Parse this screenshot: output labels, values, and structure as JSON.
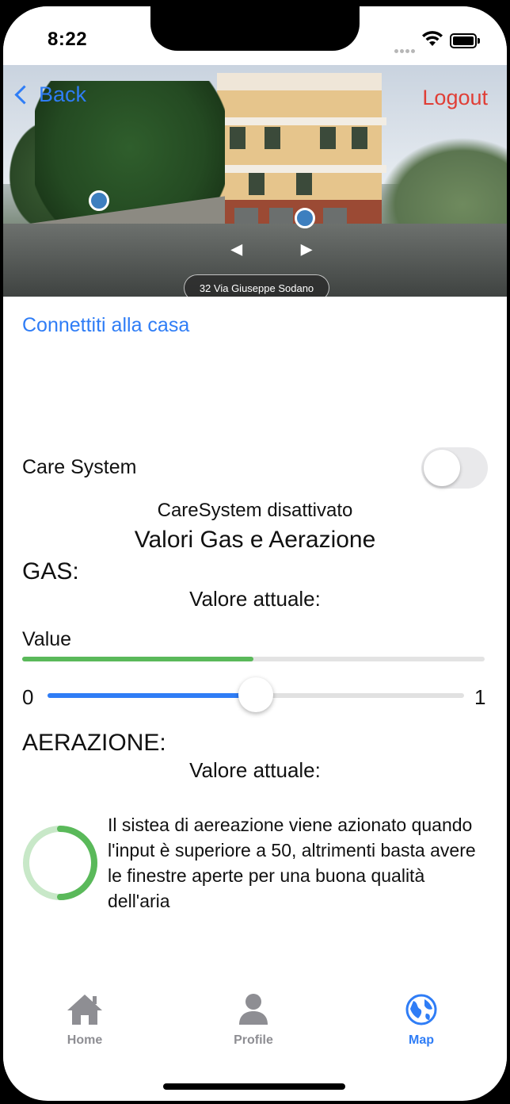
{
  "status_bar": {
    "time": "8:22"
  },
  "header": {
    "back_label": "Back",
    "logout_label": "Logout",
    "address": "32 Via Giuseppe Sodano"
  },
  "connect_link": "Connettiti alla casa",
  "care_system": {
    "label": "Care System",
    "enabled": false,
    "status": "CareSystem disattivato"
  },
  "section_title": "Valori Gas e Aerazione",
  "gas": {
    "heading": "GAS:",
    "current_label": "Valore attuale:",
    "value_label": "Value",
    "progress": 0.5,
    "slider_min": "0",
    "slider_max": "1",
    "slider_value": 0.5
  },
  "aeration": {
    "heading": "AERAZIONE:",
    "current_label": "Valore attuale:",
    "info": "Il sistea di aereazione viene azionato quando l'input è superiore a 50, altrimenti basta avere le finestre aperte per una buona qualità dell'aria"
  },
  "tabs": [
    {
      "label": "Home",
      "icon": "home-icon",
      "active": false
    },
    {
      "label": "Profile",
      "icon": "person-icon",
      "active": false
    },
    {
      "label": "Map",
      "icon": "globe-icon",
      "active": true
    }
  ],
  "colors": {
    "accent": "#2f7df6",
    "danger": "#e03e36",
    "progress": "#5ab95a",
    "inactive_tab": "#8e8e93"
  }
}
